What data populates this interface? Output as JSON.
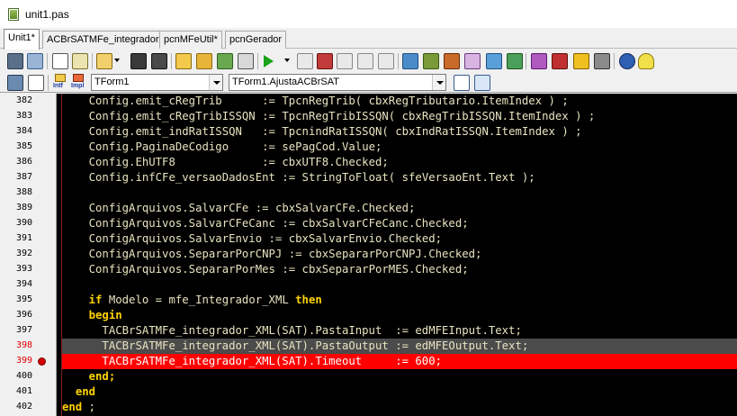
{
  "window": {
    "title": "unit1.pas"
  },
  "tabs": [
    {
      "label": "Unit1*",
      "active": true
    },
    {
      "label": "ACBrSATMFe_integrador",
      "active": false
    },
    {
      "label": "pcnMFeUtil*",
      "active": false
    },
    {
      "label": "pcnGerador",
      "active": false
    }
  ],
  "toolbar": {
    "buttons": [
      "toggle-form-unit-icon",
      "new-unit-icon",
      "open-icon",
      "save-icon",
      "save-all-icon",
      "find-icon",
      "run-icon",
      "pause-icon",
      "stop-icon",
      "step-over-icon",
      "step-into-icon",
      "step-out-icon",
      "run-to-cursor-icon",
      "components-icon",
      "palette-icon",
      "settings-icon",
      "help-icon",
      "tip-icon"
    ],
    "interface_label": "Intf",
    "implementation_label": "Impl",
    "class_combo": {
      "value": "TForm1"
    },
    "method_combo": {
      "value": "TForm1.AjustaACBrSAT"
    }
  },
  "editor": {
    "lines": [
      {
        "num": "382",
        "code": "    Config.emit_cRegTrib      := TpcnRegTrib( cbxRegTributario.ItemIndex ) ;",
        "state": "normal",
        "breakpoint": false
      },
      {
        "num": "383",
        "code": "    Config.emit_cRegTribISSQN := TpcnRegTribISSQN( cbxRegTribISSQN.ItemIndex ) ;",
        "state": "normal",
        "breakpoint": false
      },
      {
        "num": "384",
        "code": "    Config.emit_indRatISSQN   := TpcnindRatISSQN( cbxIndRatISSQN.ItemIndex ) ;",
        "state": "normal",
        "breakpoint": false
      },
      {
        "num": "385",
        "code": "    Config.PaginaDeCodigo     := sePagCod.Value;",
        "state": "normal",
        "breakpoint": false
      },
      {
        "num": "386",
        "code": "    Config.EhUTF8             := cbxUTF8.Checked;",
        "state": "normal",
        "breakpoint": false
      },
      {
        "num": "387",
        "code": "    Config.infCFe_versaoDadosEnt := StringToFloat( sfeVersaoEnt.Text );",
        "state": "normal",
        "breakpoint": false
      },
      {
        "num": "388",
        "code": "",
        "state": "normal",
        "breakpoint": false
      },
      {
        "num": "389",
        "code": "    ConfigArquivos.SalvarCFe := cbxSalvarCFe.Checked;",
        "state": "normal",
        "breakpoint": false
      },
      {
        "num": "390",
        "code": "    ConfigArquivos.SalvarCFeCanc := cbxSalvarCFeCanc.Checked;",
        "state": "normal",
        "breakpoint": false
      },
      {
        "num": "391",
        "code": "    ConfigArquivos.SalvarEnvio := cbxSalvarEnvio.Checked;",
        "state": "normal",
        "breakpoint": false
      },
      {
        "num": "392",
        "code": "    ConfigArquivos.SepararPorCNPJ := cbxSepararPorCNPJ.Checked;",
        "state": "normal",
        "breakpoint": false
      },
      {
        "num": "393",
        "code": "    ConfigArquivos.SepararPorMes := cbxSepararPorMES.Checked;",
        "state": "normal",
        "breakpoint": false
      },
      {
        "num": "394",
        "code": "",
        "state": "normal",
        "breakpoint": false
      },
      {
        "num": "395",
        "code": "    if Modelo = mfe_Integrador_XML then",
        "state": "normal",
        "breakpoint": false
      },
      {
        "num": "396",
        "code": "    begin",
        "state": "normal",
        "breakpoint": false
      },
      {
        "num": "397",
        "code": "      TACBrSATMFe_integrador_XML(SAT).PastaInput  := edMFEInput.Text;",
        "state": "normal",
        "breakpoint": false
      },
      {
        "num": "398",
        "code": "      TACBrSATMFe_integrador_XML(SAT).PastaOutput := edMFEOutput.Text;",
        "state": "exec",
        "breakpoint": false
      },
      {
        "num": "399",
        "code": "      TACBrSATMFe_integrador_XML(SAT).Timeout     := 600;",
        "state": "error",
        "breakpoint": true
      },
      {
        "num": "400",
        "code": "    end;",
        "state": "normal",
        "breakpoint": false
      },
      {
        "num": "401",
        "code": "  end",
        "state": "normal",
        "breakpoint": false
      },
      {
        "num": "402",
        "code": "end ;",
        "state": "normal",
        "breakpoint": false
      }
    ],
    "keywords": [
      "if",
      "then",
      "begin",
      "end",
      "end;"
    ]
  }
}
